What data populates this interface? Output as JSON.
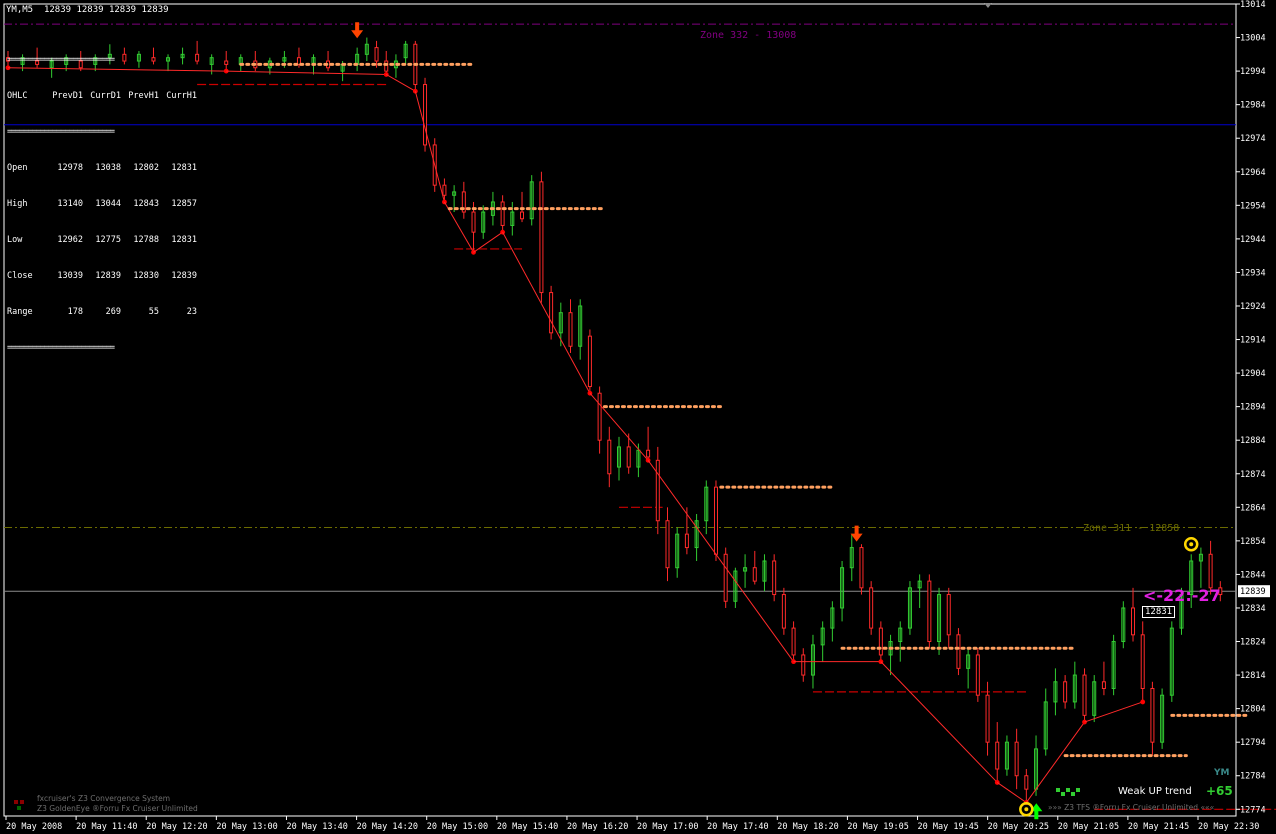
{
  "header": {
    "symbol_tf": "YM,M5",
    "ohlc": "12839 12839 12839 12839"
  },
  "table": {
    "columns": [
      "OHLC",
      "PrevD1",
      "CurrD1",
      "PrevH1",
      "CurrH1"
    ],
    "rows": [
      {
        "label": "Open",
        "values": [
          "12978",
          "13038",
          "12802",
          "12831"
        ]
      },
      {
        "label": "High",
        "values": [
          "13140",
          "13044",
          "12843",
          "12857"
        ]
      },
      {
        "label": "Low",
        "values": [
          "12962",
          "12775",
          "12788",
          "12831"
        ]
      },
      {
        "label": "Close",
        "values": [
          "13039",
          "12839",
          "12830",
          "12839"
        ]
      },
      {
        "label": "Range",
        "values": [
          "178",
          "269",
          "55",
          "23"
        ]
      }
    ],
    "rule": "=========================="
  },
  "zones": {
    "upper": "Zone 332 - 13008",
    "lower": "Zone 311 - 12858"
  },
  "countdown": "<-22:-27",
  "price_labels": {
    "current": "12839",
    "second": "12831"
  },
  "trend": {
    "label": "Weak UP trend",
    "value": "+65",
    "symbol": "YM"
  },
  "footer": {
    "left1": "fxcruiser's Z3 Convergence System",
    "left2": "Z3 GoldenEye ®Forru Fx Cruiser Unlimited",
    "right": "»»» Z3 TFS ®Forru Fx Cruiser Unlimited «««"
  },
  "colors": {
    "background": "#000000",
    "bull": "#32CD32",
    "bear": "#FF2A2A",
    "dotted": "#FFA060",
    "zone_upper": "#800080",
    "zone_lower": "#6B6B00",
    "blue_line": "#0000CD",
    "grey_line": "#8C8C8C",
    "countdown": "#E020E0",
    "support_dash": "#CC0000",
    "arrow_down": "#FF4400",
    "arrow_up": "#00FF00"
  },
  "chart_data": {
    "type": "candlestick",
    "symbol": "YM,M5",
    "ylim": [
      12772,
      13014
    ],
    "y_ticks": [
      13014,
      13004,
      12994,
      12984,
      12974,
      12964,
      12954,
      12944,
      12934,
      12924,
      12914,
      12904,
      12894,
      12884,
      12874,
      12864,
      12854,
      12844,
      12834,
      12824,
      12814,
      12804,
      12794,
      12784,
      12774
    ],
    "x_ticks": [
      "20 May 2008",
      "20 May 11:40",
      "20 May 12:20",
      "20 May 13:00",
      "20 May 13:40",
      "20 May 14:20",
      "20 May 15:00",
      "20 May 15:40",
      "20 May 16:20",
      "20 May 17:00",
      "20 May 17:40",
      "20 May 18:20",
      "20 May 19:05",
      "20 May 19:45",
      "20 May 20:25",
      "20 May 21:05",
      "20 May 21:45",
      "20 May 22:30"
    ],
    "n_bars": 252,
    "horizontal_lines": [
      {
        "name": "Zone 332 - 13008",
        "y": 13008,
        "style": "dash-dot"
      },
      {
        "name": "blue",
        "y": 12978,
        "style": "solid"
      },
      {
        "name": "Zone 311 - 12858",
        "y": 12858,
        "style": "dash-dot"
      },
      {
        "name": "bid",
        "y": 12839,
        "style": "solid"
      }
    ],
    "segments_dotted": [
      {
        "x0": 48,
        "x1": 96,
        "y": 12996
      },
      {
        "x0": 91,
        "x1": 123,
        "y": 12953
      },
      {
        "x0": 123,
        "x1": 147,
        "y": 12894
      },
      {
        "x0": 147,
        "x1": 170,
        "y": 12870
      },
      {
        "x0": 172,
        "x1": 220,
        "y": 12822
      },
      {
        "x0": 218,
        "x1": 243,
        "y": 12790
      },
      {
        "x0": 240,
        "x1": 256,
        "y": 12802
      },
      {
        "x0": 268,
        "x1": 287,
        "y": 12831
      }
    ],
    "segments_dashed": [
      {
        "x0": 39,
        "x1": 78,
        "y": 12990
      },
      {
        "x0": 92,
        "x1": 106,
        "y": 12941
      },
      {
        "x0": 126,
        "x1": 135,
        "y": 12864
      },
      {
        "x0": 166,
        "x1": 210,
        "y": 12809
      },
      {
        "x0": 224,
        "x1": 276,
        "y": 12774
      }
    ],
    "candles": [
      {
        "x": 0,
        "o": 12998,
        "h": 13000,
        "l": 12995,
        "c": 12997
      },
      {
        "x": 3,
        "o": 12996,
        "h": 12999,
        "l": 12994,
        "c": 12998
      },
      {
        "x": 6,
        "o": 12997,
        "h": 13001,
        "l": 12995,
        "c": 12996
      },
      {
        "x": 9,
        "o": 12995,
        "h": 12998,
        "l": 12992,
        "c": 12997
      },
      {
        "x": 12,
        "o": 12996,
        "h": 12999,
        "l": 12994,
        "c": 12998
      },
      {
        "x": 15,
        "o": 12997,
        "h": 13000,
        "l": 12994,
        "c": 12995
      },
      {
        "x": 18,
        "o": 12996,
        "h": 12999,
        "l": 12994,
        "c": 12998
      },
      {
        "x": 21,
        "o": 12998,
        "h": 13002,
        "l": 12996,
        "c": 12999
      },
      {
        "x": 24,
        "o": 12999,
        "h": 13001,
        "l": 12996,
        "c": 12997
      },
      {
        "x": 27,
        "o": 12997,
        "h": 13000,
        "l": 12995,
        "c": 12999
      },
      {
        "x": 30,
        "o": 12998,
        "h": 13001,
        "l": 12996,
        "c": 12997
      },
      {
        "x": 33,
        "o": 12997,
        "h": 12999,
        "l": 12994,
        "c": 12998
      },
      {
        "x": 36,
        "o": 12998,
        "h": 13001,
        "l": 12996,
        "c": 12999
      },
      {
        "x": 39,
        "o": 12999,
        "h": 13003,
        "l": 12996,
        "c": 12997
      },
      {
        "x": 42,
        "o": 12996,
        "h": 12999,
        "l": 12993,
        "c": 12998
      },
      {
        "x": 45,
        "o": 12997,
        "h": 13000,
        "l": 12994,
        "c": 12996
      },
      {
        "x": 48,
        "o": 12996,
        "h": 12999,
        "l": 12994,
        "c": 12998
      },
      {
        "x": 51,
        "o": 12997,
        "h": 13000,
        "l": 12994,
        "c": 12995
      },
      {
        "x": 54,
        "o": 12995,
        "h": 12998,
        "l": 12993,
        "c": 12997
      },
      {
        "x": 57,
        "o": 12997,
        "h": 13000,
        "l": 12995,
        "c": 12998
      },
      {
        "x": 60,
        "o": 12998,
        "h": 13001,
        "l": 12995,
        "c": 12996
      },
      {
        "x": 63,
        "o": 12996,
        "h": 12999,
        "l": 12993,
        "c": 12998
      },
      {
        "x": 66,
        "o": 12997,
        "h": 13000,
        "l": 12994,
        "c": 12995
      },
      {
        "x": 69,
        "o": 12994,
        "h": 12997,
        "l": 12991,
        "c": 12996
      },
      {
        "x": 72,
        "o": 12996,
        "h": 13001,
        "l": 12994,
        "c": 12999
      },
      {
        "x": 74,
        "o": 12999,
        "h": 13004,
        "l": 12997,
        "c": 13002
      },
      {
        "x": 76,
        "o": 13001,
        "h": 13003,
        "l": 12995,
        "c": 12997
      },
      {
        "x": 78,
        "o": 12997,
        "h": 13000,
        "l": 12993,
        "c": 12994
      },
      {
        "x": 80,
        "o": 12995,
        "h": 12999,
        "l": 12992,
        "c": 12997
      },
      {
        "x": 82,
        "o": 12998,
        "h": 13003,
        "l": 12996,
        "c": 13002
      },
      {
        "x": 84,
        "o": 13002,
        "h": 13003,
        "l": 12988,
        "c": 12990
      },
      {
        "x": 86,
        "o": 12990,
        "h": 12992,
        "l": 12970,
        "c": 12972
      },
      {
        "x": 88,
        "o": 12972,
        "h": 12974,
        "l": 12958,
        "c": 12960
      },
      {
        "x": 90,
        "o": 12960,
        "h": 12962,
        "l": 12955,
        "c": 12957
      },
      {
        "x": 92,
        "o": 12957,
        "h": 12960,
        "l": 12952,
        "c": 12958
      },
      {
        "x": 94,
        "o": 12958,
        "h": 12961,
        "l": 12950,
        "c": 12952
      },
      {
        "x": 96,
        "o": 12952,
        "h": 12955,
        "l": 12940,
        "c": 12946
      },
      {
        "x": 98,
        "o": 12946,
        "h": 12954,
        "l": 12944,
        "c": 12952
      },
      {
        "x": 100,
        "o": 12951,
        "h": 12958,
        "l": 12948,
        "c": 12955
      },
      {
        "x": 102,
        "o": 12955,
        "h": 12957,
        "l": 12946,
        "c": 12948
      },
      {
        "x": 104,
        "o": 12948,
        "h": 12955,
        "l": 12945,
        "c": 12952
      },
      {
        "x": 106,
        "o": 12952,
        "h": 12958,
        "l": 12949,
        "c": 12950
      },
      {
        "x": 108,
        "o": 12950,
        "h": 12963,
        "l": 12948,
        "c": 12961
      },
      {
        "x": 110,
        "o": 12961,
        "h": 12964,
        "l": 12925,
        "c": 12928
      },
      {
        "x": 112,
        "o": 12928,
        "h": 12930,
        "l": 12914,
        "c": 12916
      },
      {
        "x": 114,
        "o": 12916,
        "h": 12925,
        "l": 12912,
        "c": 12922
      },
      {
        "x": 116,
        "o": 12922,
        "h": 12926,
        "l": 12910,
        "c": 12912
      },
      {
        "x": 118,
        "o": 12912,
        "h": 12926,
        "l": 12908,
        "c": 12924
      },
      {
        "x": 120,
        "o": 12915,
        "h": 12917,
        "l": 12898,
        "c": 12900
      },
      {
        "x": 122,
        "o": 12898,
        "h": 12900,
        "l": 12880,
        "c": 12884
      },
      {
        "x": 124,
        "o": 12884,
        "h": 12888,
        "l": 12870,
        "c": 12874
      },
      {
        "x": 126,
        "o": 12876,
        "h": 12885,
        "l": 12872,
        "c": 12882
      },
      {
        "x": 128,
        "o": 12882,
        "h": 12886,
        "l": 12874,
        "c": 12876
      },
      {
        "x": 130,
        "o": 12876,
        "h": 12883,
        "l": 12873,
        "c": 12881
      },
      {
        "x": 132,
        "o": 12881,
        "h": 12888,
        "l": 12878,
        "c": 12879
      },
      {
        "x": 134,
        "o": 12878,
        "h": 12882,
        "l": 12856,
        "c": 12860
      },
      {
        "x": 136,
        "o": 12860,
        "h": 12864,
        "l": 12842,
        "c": 12846
      },
      {
        "x": 138,
        "o": 12846,
        "h": 12858,
        "l": 12843,
        "c": 12856
      },
      {
        "x": 140,
        "o": 12856,
        "h": 12864,
        "l": 12850,
        "c": 12852
      },
      {
        "x": 142,
        "o": 12852,
        "h": 12862,
        "l": 12848,
        "c": 12860
      },
      {
        "x": 144,
        "o": 12860,
        "h": 12872,
        "l": 12856,
        "c": 12870
      },
      {
        "x": 146,
        "o": 12870,
        "h": 12872,
        "l": 12848,
        "c": 12850
      },
      {
        "x": 148,
        "o": 12850,
        "h": 12852,
        "l": 12834,
        "c": 12836
      },
      {
        "x": 150,
        "o": 12836,
        "h": 12846,
        "l": 12834,
        "c": 12845
      },
      {
        "x": 152,
        "o": 12845,
        "h": 12850,
        "l": 12840,
        "c": 12846
      },
      {
        "x": 154,
        "o": 12846,
        "h": 12851,
        "l": 12841,
        "c": 12842
      },
      {
        "x": 156,
        "o": 12842,
        "h": 12850,
        "l": 12839,
        "c": 12848
      },
      {
        "x": 158,
        "o": 12848,
        "h": 12850,
        "l": 12836,
        "c": 12838
      },
      {
        "x": 160,
        "o": 12838,
        "h": 12840,
        "l": 12826,
        "c": 12828
      },
      {
        "x": 162,
        "o": 12828,
        "h": 12830,
        "l": 12818,
        "c": 12820
      },
      {
        "x": 164,
        "o": 12820,
        "h": 12822,
        "l": 12812,
        "c": 12814
      },
      {
        "x": 166,
        "o": 12814,
        "h": 12826,
        "l": 12810,
        "c": 12823
      },
      {
        "x": 168,
        "o": 12823,
        "h": 12830,
        "l": 12818,
        "c": 12828
      },
      {
        "x": 170,
        "o": 12828,
        "h": 12836,
        "l": 12824,
        "c": 12834
      },
      {
        "x": 172,
        "o": 12834,
        "h": 12848,
        "l": 12830,
        "c": 12846
      },
      {
        "x": 174,
        "o": 12846,
        "h": 12856,
        "l": 12842,
        "c": 12852
      },
      {
        "x": 176,
        "o": 12852,
        "h": 12853,
        "l": 12838,
        "c": 12840
      },
      {
        "x": 178,
        "o": 12840,
        "h": 12842,
        "l": 12826,
        "c": 12828
      },
      {
        "x": 180,
        "o": 12828,
        "h": 12830,
        "l": 12818,
        "c": 12820
      },
      {
        "x": 182,
        "o": 12820,
        "h": 12826,
        "l": 12814,
        "c": 12824
      },
      {
        "x": 184,
        "o": 12824,
        "h": 12830,
        "l": 12818,
        "c": 12828
      },
      {
        "x": 186,
        "o": 12828,
        "h": 12842,
        "l": 12826,
        "c": 12840
      },
      {
        "x": 188,
        "o": 12840,
        "h": 12844,
        "l": 12834,
        "c": 12842
      },
      {
        "x": 190,
        "o": 12842,
        "h": 12844,
        "l": 12822,
        "c": 12824
      },
      {
        "x": 192,
        "o": 12824,
        "h": 12840,
        "l": 12820,
        "c": 12838
      },
      {
        "x": 194,
        "o": 12838,
        "h": 12840,
        "l": 12822,
        "c": 12826
      },
      {
        "x": 196,
        "o": 12826,
        "h": 12828,
        "l": 12814,
        "c": 12816
      },
      {
        "x": 198,
        "o": 12816,
        "h": 12822,
        "l": 12810,
        "c": 12820
      },
      {
        "x": 200,
        "o": 12820,
        "h": 12822,
        "l": 12806,
        "c": 12808
      },
      {
        "x": 202,
        "o": 12808,
        "h": 12812,
        "l": 12790,
        "c": 12794
      },
      {
        "x": 204,
        "o": 12794,
        "h": 12800,
        "l": 12782,
        "c": 12786
      },
      {
        "x": 206,
        "o": 12786,
        "h": 12796,
        "l": 12784,
        "c": 12794
      },
      {
        "x": 208,
        "o": 12794,
        "h": 12798,
        "l": 12780,
        "c": 12784
      },
      {
        "x": 210,
        "o": 12784,
        "h": 12786,
        "l": 12776,
        "c": 12780
      },
      {
        "x": 212,
        "o": 12780,
        "h": 12796,
        "l": 12778,
        "c": 12792
      },
      {
        "x": 214,
        "o": 12792,
        "h": 12810,
        "l": 12790,
        "c": 12806
      },
      {
        "x": 216,
        "o": 12806,
        "h": 12816,
        "l": 12802,
        "c": 12812
      },
      {
        "x": 218,
        "o": 12812,
        "h": 12814,
        "l": 12804,
        "c": 12806
      },
      {
        "x": 220,
        "o": 12806,
        "h": 12818,
        "l": 12804,
        "c": 12814
      },
      {
        "x": 222,
        "o": 12814,
        "h": 12816,
        "l": 12800,
        "c": 12802
      },
      {
        "x": 224,
        "o": 12802,
        "h": 12814,
        "l": 12800,
        "c": 12812
      },
      {
        "x": 226,
        "o": 12812,
        "h": 12818,
        "l": 12808,
        "c": 12810
      },
      {
        "x": 228,
        "o": 12810,
        "h": 12826,
        "l": 12808,
        "c": 12824
      },
      {
        "x": 230,
        "o": 12824,
        "h": 12836,
        "l": 12822,
        "c": 12834
      },
      {
        "x": 232,
        "o": 12834,
        "h": 12840,
        "l": 12824,
        "c": 12826
      },
      {
        "x": 234,
        "o": 12826,
        "h": 12830,
        "l": 12806,
        "c": 12810
      },
      {
        "x": 236,
        "o": 12810,
        "h": 12812,
        "l": 12790,
        "c": 12794
      },
      {
        "x": 238,
        "o": 12794,
        "h": 12810,
        "l": 12792,
        "c": 12808
      },
      {
        "x": 240,
        "o": 12808,
        "h": 12830,
        "l": 12806,
        "c": 12828
      },
      {
        "x": 242,
        "o": 12828,
        "h": 12840,
        "l": 12826,
        "c": 12838
      },
      {
        "x": 244,
        "o": 12838,
        "h": 12850,
        "l": 12834,
        "c": 12848
      },
      {
        "x": 246,
        "o": 12848,
        "h": 12852,
        "l": 12840,
        "c": 12850
      },
      {
        "x": 248,
        "o": 12850,
        "h": 12854,
        "l": 12838,
        "c": 12840
      },
      {
        "x": 250,
        "o": 12840,
        "h": 12842,
        "l": 12836,
        "c": 12838
      }
    ],
    "markers_down_arrows": [
      {
        "x": 72,
        "y": 13002
      },
      {
        "x": 175,
        "y": 12852
      }
    ],
    "markers_up_arrows": [
      {
        "x": 210,
        "y": 12774
      }
    ],
    "markers_yellow_circles": [
      {
        "x": 210,
        "y": 12774
      },
      {
        "x": 244,
        "y": 12853
      }
    ]
  }
}
